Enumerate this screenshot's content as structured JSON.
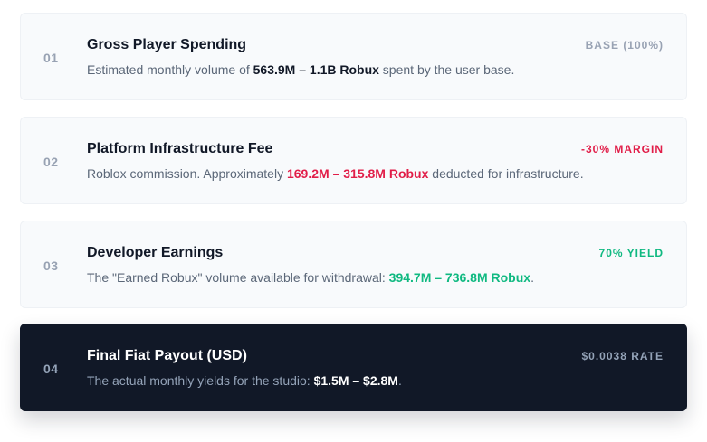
{
  "steps": [
    {
      "number": "01",
      "title": "Gross Player Spending",
      "badge": "BASE (100%)",
      "desc_prefix": "Estimated monthly volume of ",
      "desc_value": "563.9M – 1.1B Robux",
      "desc_suffix": " spent by the user base."
    },
    {
      "number": "02",
      "title": "Platform Infrastructure Fee",
      "badge": "-30% MARGIN",
      "desc_prefix": "Roblox commission. Approximately ",
      "desc_value": "169.2M – 315.8M Robux",
      "desc_suffix": " deducted for infrastructure."
    },
    {
      "number": "03",
      "title": "Developer Earnings",
      "badge": "70% YIELD",
      "desc_prefix": "The \"Earned Robux\" volume available for withdrawal: ",
      "desc_value": "394.7M – 736.8M Robux",
      "desc_suffix": "."
    },
    {
      "number": "04",
      "title": "Final Fiat Payout (USD)",
      "badge": "$0.0038 RATE",
      "desc_prefix": "The actual monthly yields for the studio: ",
      "desc_value": "$1.5M – $2.8M",
      "desc_suffix": "."
    }
  ],
  "colors": {
    "card_bg": "#f8fafc",
    "dark_card_bg": "#111827",
    "red_accent": "#e11d48",
    "green_accent": "#10b981",
    "muted": "#98a2b3"
  }
}
